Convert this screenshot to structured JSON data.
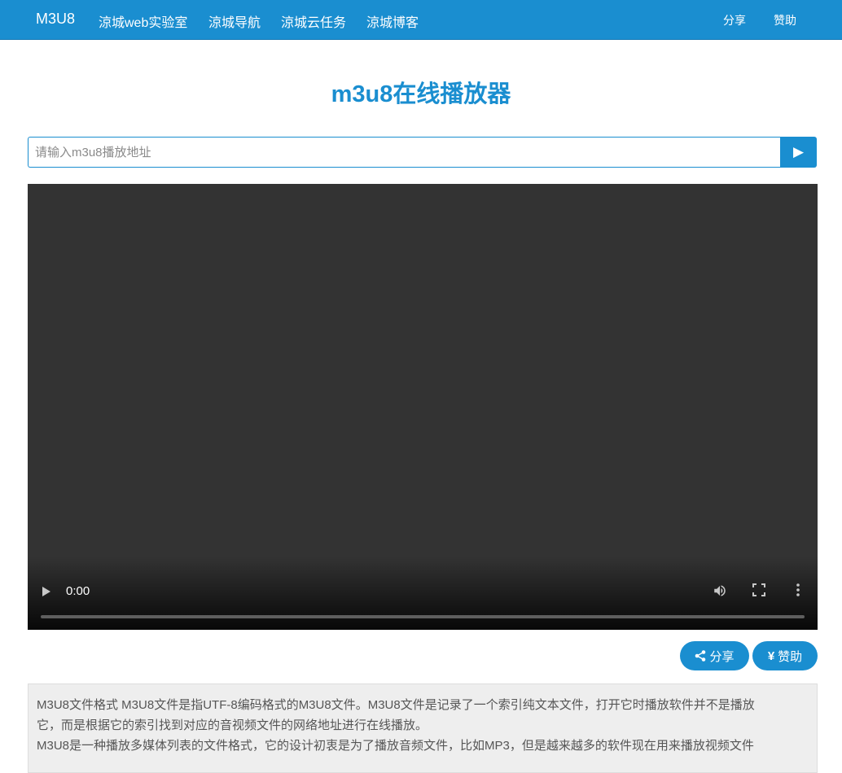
{
  "navbar": {
    "brand": "M3U8",
    "links": [
      "涼城web实验室",
      "涼城导航",
      "涼城云任务",
      "涼城博客"
    ],
    "share": "分享",
    "donate": "赞助"
  },
  "main": {
    "title": "m3u8在线播放器",
    "url_placeholder": "请输入m3u8播放地址",
    "play_button_glyph": "▶"
  },
  "player": {
    "time": "0:00",
    "progress": 0
  },
  "actions": {
    "share_label": "分享",
    "donate_symbol": "¥",
    "donate_label": "赞助"
  },
  "description": {
    "lines": [
      "M3U8文件格式 M3U8文件是指UTF-8编码格式的M3U8文件。M3U8文件是记录了一个索引纯文本文件，打开它时播放软件并不是播放",
      "它，而是根据它的索引找到对应的音视频文件的网络地址进行在线播放。",
      "M3U8是一种播放多媒体列表的文件格式，它的设计初衷是为了播放音频文件，比如MP3，但是越来越多的软件现在用来播放视频文件"
    ]
  },
  "colors": {
    "primary": "#1a8ed0",
    "player_bg": "#333333",
    "desc_bg": "#eeeeee"
  }
}
